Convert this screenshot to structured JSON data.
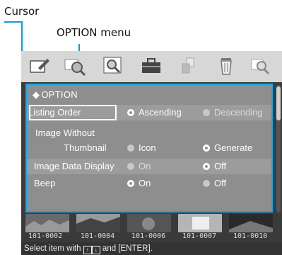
{
  "callouts": {
    "cursor": "Cursor",
    "option_menu": "OPTION menu"
  },
  "toolbar": {
    "icons": [
      "pencil-edit-icon",
      "zoom-search-icon",
      "image-search-icon",
      "toolbox-icon",
      "copy-icon",
      "trash-icon",
      "rotate-search-icon"
    ]
  },
  "menu": {
    "title": "OPTION",
    "title_symbol": "◆",
    "rows": [
      {
        "label": "Listing Order",
        "options": [
          {
            "text": "Ascending",
            "selected": true
          },
          {
            "text": "Descending",
            "selected": false
          }
        ]
      },
      {
        "label_line1": "Image Without",
        "label_line2": "Thumbnail",
        "options": [
          {
            "text": "Icon",
            "selected": false
          },
          {
            "text": "Generate",
            "selected": true
          }
        ]
      },
      {
        "label": "Image  Data Display",
        "options": [
          {
            "text": "On",
            "selected": false
          },
          {
            "text": "Off",
            "selected": true
          }
        ]
      },
      {
        "label": "Beep",
        "options": [
          {
            "text": "On",
            "selected": true
          },
          {
            "text": "Off",
            "selected": false
          }
        ]
      }
    ]
  },
  "thumbnails": [
    "101-0002",
    "101-0004",
    "101-0006",
    "101-0007",
    "101-0010"
  ],
  "status": {
    "prefix": "Select item with ",
    "suffix": " and [ENTER].",
    "keys": [
      "↑",
      "↓"
    ]
  },
  "colors": {
    "highlight": "#17a7e6",
    "panel": "#8e8e8e",
    "toolbar": "#d7d7d7"
  }
}
